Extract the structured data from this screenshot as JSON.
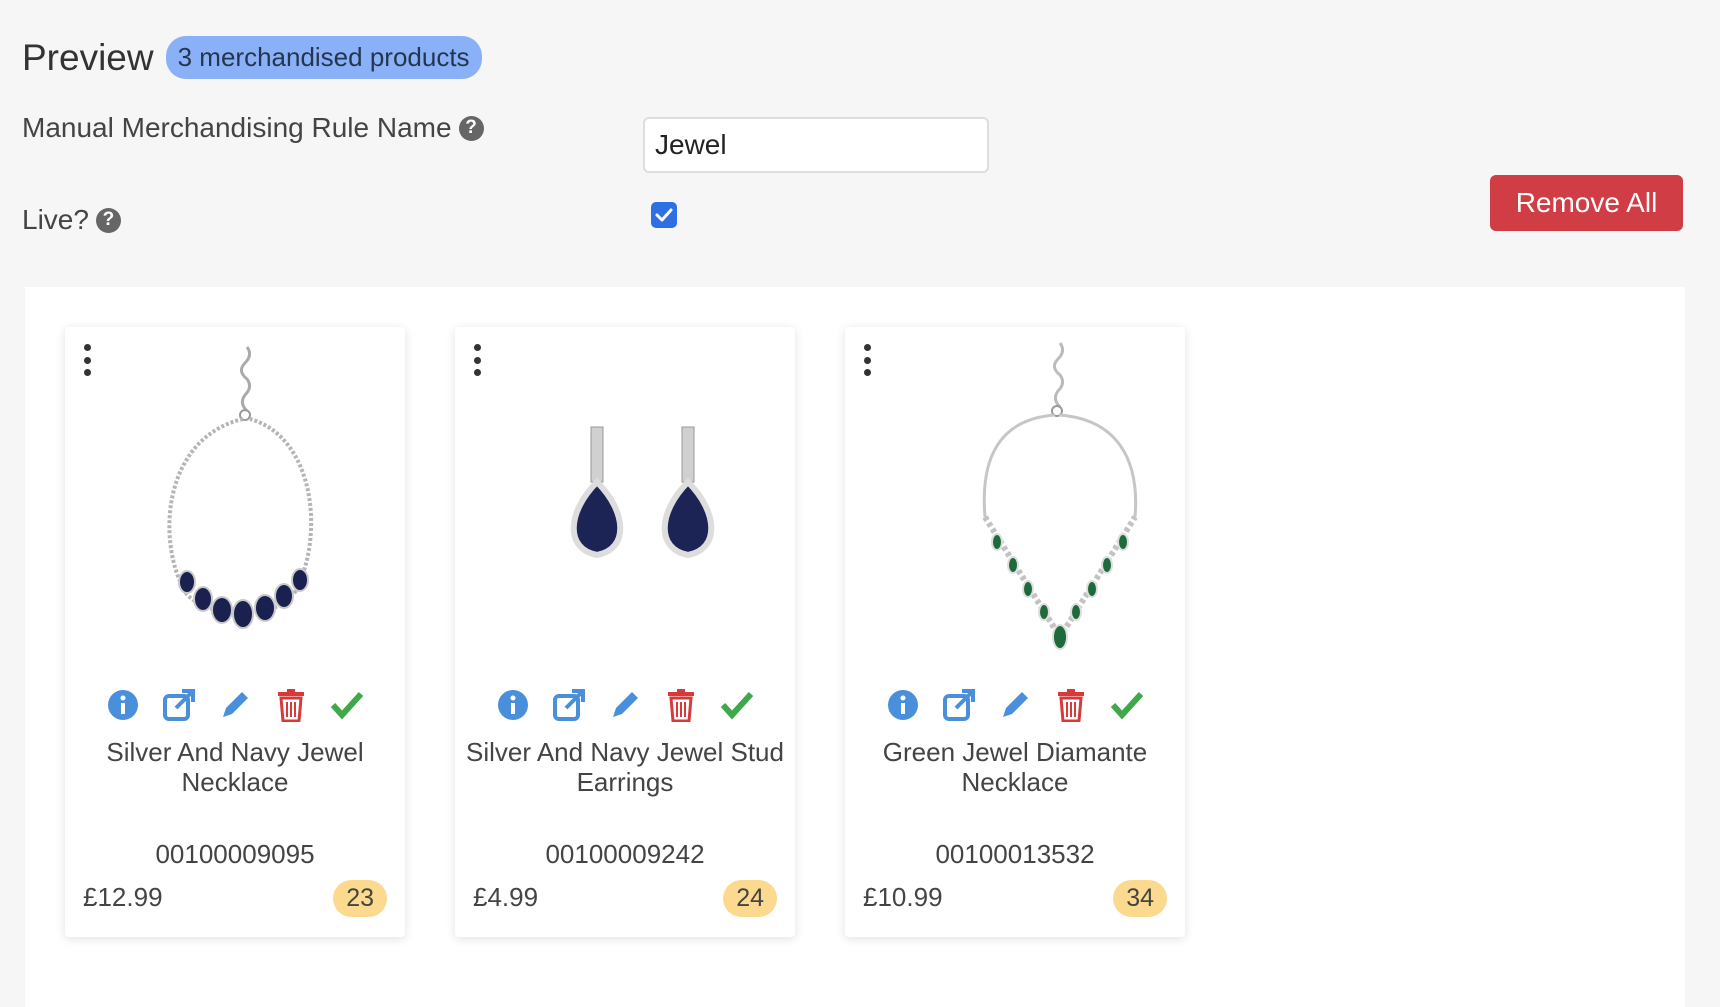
{
  "header": {
    "title": "Preview",
    "badge": "3 merchandised products"
  },
  "form": {
    "rule_name_label": "Manual Merchandising Rule Name",
    "rule_name_value": "Jewel",
    "live_label": "Live?",
    "live_checked": true,
    "help_icon": "?",
    "remove_all_label": "Remove All"
  },
  "colors": {
    "badge_bg": "#8ab1f7",
    "remove_button": "#d13d45",
    "action_blue": "#4a8fdb",
    "delete_red": "#d83a3a",
    "check_green": "#3ea84a",
    "count_badge": "#fbd98f"
  },
  "products": [
    {
      "name": "Silver And Navy Jewel Necklace",
      "sku": "00100009095",
      "price": "£12.99",
      "count": "23",
      "image": "navy-necklace"
    },
    {
      "name": "Silver And Navy Jewel Stud Earrings",
      "sku": "00100009242",
      "price": "£4.99",
      "count": "24",
      "image": "navy-earrings"
    },
    {
      "name": "Green Jewel Diamante Necklace",
      "sku": "00100013532",
      "price": "£10.99",
      "count": "34",
      "image": "green-necklace"
    }
  ],
  "card_icons": [
    "info-icon",
    "external-link-icon",
    "edit-pencil-icon",
    "trash-icon",
    "check-icon"
  ]
}
